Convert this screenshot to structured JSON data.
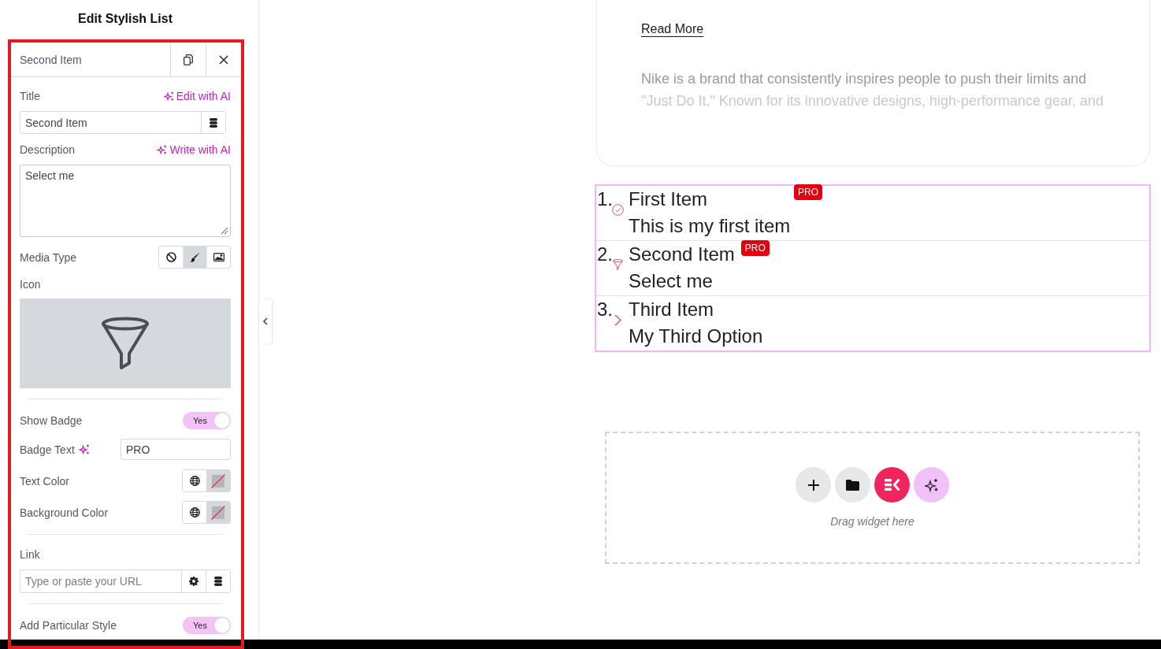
{
  "editor": {
    "title": "Edit Stylish List"
  },
  "item_panel": {
    "title": "Second Item",
    "fields": [
      {
        "kind": "text",
        "label": "Title",
        "ai_action": "Edit with AI",
        "value": "Second Item"
      },
      {
        "kind": "textarea",
        "label": "Description",
        "ai_action": "Write with AI",
        "value": "Select me"
      },
      {
        "kind": "choice",
        "label": "Media Type",
        "options": [
          {
            "selected": false
          },
          {
            "selected": true
          },
          {
            "selected": false
          }
        ]
      },
      {
        "kind": "icon",
        "label": "Icon"
      },
      {
        "kind": "divider"
      },
      {
        "kind": "toggle",
        "label": "Show Badge",
        "on": true,
        "state_label": "Yes"
      },
      {
        "kind": "short_text",
        "label": "Badge Text",
        "ai": true,
        "value": "PRO"
      },
      {
        "kind": "color",
        "label": "Text Color"
      },
      {
        "kind": "color",
        "label": "Background Color"
      },
      {
        "kind": "divider"
      },
      {
        "kind": "url",
        "label": "Link",
        "placeholder": "Type or paste your URL"
      },
      {
        "kind": "divider"
      },
      {
        "kind": "toggle",
        "label": "Add Particular Style",
        "on": true,
        "state_label": "Yes"
      }
    ]
  },
  "canvas": {
    "card": {
      "link": "Read More",
      "text_lines": [
        "Nike is a brand that consistently inspires people to push their limits and",
        "\"Just Do It.\" Known for its innovative designs, high-performance gear, and"
      ]
    },
    "list": {
      "items": [
        {
          "number": "1.",
          "title": "First Item",
          "description": "This is my first item",
          "badge": {
            "text": "PRO",
            "kind": "floating"
          }
        },
        {
          "number": "2.",
          "title": "Second Item",
          "description": "Select me",
          "badge": {
            "text": "PRO",
            "kind": "inline"
          }
        },
        {
          "number": "3.",
          "title": "Third Item",
          "description": "My Third Option"
        }
      ]
    },
    "drop_zone": {
      "hint": "Drag widget here"
    }
  }
}
